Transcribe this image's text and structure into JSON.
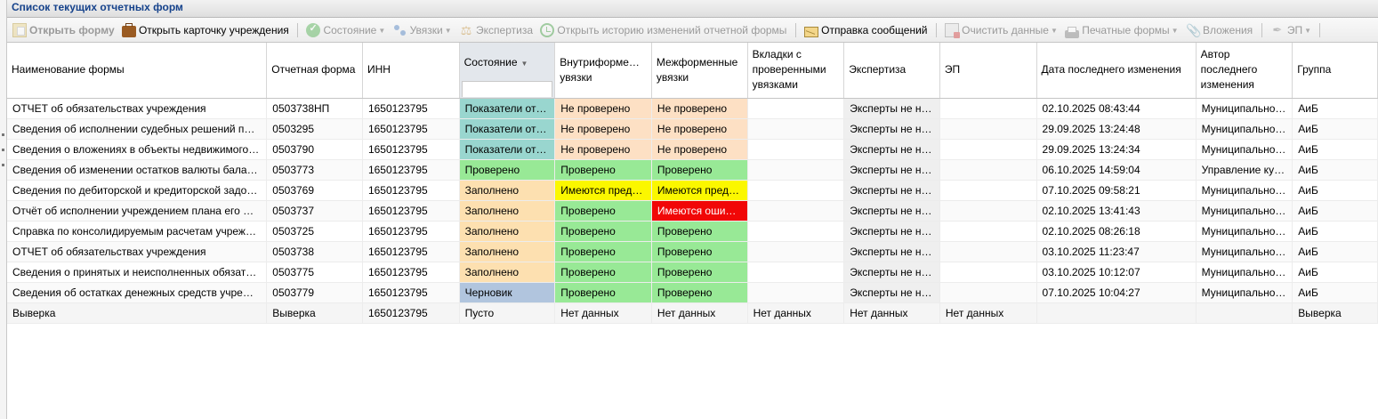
{
  "window": {
    "title": "Список текущих отчетных форм"
  },
  "colors": {
    "status_blue": "#99d6cf",
    "status_peach": "#fde0c4",
    "status_green": "#98e996",
    "status_orange": "#fde0b0",
    "status_yellow": "#fbf700",
    "status_red": "#f10707",
    "status_draft": "#b1c5de"
  },
  "toolbar": {
    "open_form": "Открыть форму",
    "open_card": "Открыть карточку учреждения",
    "state": "Состояние",
    "links": "Увязки",
    "expertise": "Экспертиза",
    "history": "Открыть историю изменений отчетной формы",
    "send_messages": "Отправка сообщений",
    "clear_data": "Очистить данные",
    "print_forms": "Печатные формы",
    "attachments": "Вложения",
    "ep": "ЭП"
  },
  "grid": {
    "columns": {
      "name": "Наименование формы",
      "report_form": "Отчетная форма",
      "inn": "ИНН",
      "state": "Состояние",
      "intra": [
        "Внутриформе…",
        "увязки"
      ],
      "inter": [
        "Межформенные",
        "увязки"
      ],
      "tabs": [
        "Вкладки с",
        "проверенными",
        "увязками"
      ],
      "expertise": "Экспертиза",
      "ep": "ЭП",
      "last_change": "Дата последнего изменения",
      "author": [
        "Автор",
        "последнего",
        "изменения"
      ],
      "group": "Группа"
    },
    "rows": [
      {
        "name": "ОТЧЕТ об обязательствах учреждения",
        "form": "0503738НП",
        "inn": "1650123795",
        "state": "Показатели от…",
        "intra": "Не проверено",
        "inter": "Не проверено",
        "tabs": "",
        "expertise": "Эксперты не н…",
        "ep": "",
        "date": "02.10.2025 08:43:44",
        "author": "Муниципально…",
        "group": "АиБ"
      },
      {
        "name": "Сведения об исполнении судебных решений п…",
        "form": "0503295",
        "inn": "1650123795",
        "state": "Показатели от…",
        "intra": "Не проверено",
        "inter": "Не проверено",
        "tabs": "",
        "expertise": "Эксперты не н…",
        "ep": "",
        "date": "29.09.2025 13:24:48",
        "author": "Муниципально…",
        "group": "АиБ"
      },
      {
        "name": "Сведения о вложениях в объекты недвижимого…",
        "form": "0503790",
        "inn": "1650123795",
        "state": "Показатели от…",
        "intra": "Не проверено",
        "inter": "Не проверено",
        "tabs": "",
        "expertise": "Эксперты не н…",
        "ep": "",
        "date": "29.09.2025 13:24:34",
        "author": "Муниципально…",
        "group": "АиБ"
      },
      {
        "name": "Сведения об изменении остатков валюты бала…",
        "form": "0503773",
        "inn": "1650123795",
        "state": "Проверено",
        "intra": "Проверено",
        "inter": "Проверено",
        "tabs": "",
        "expertise": "Эксперты не н…",
        "ep": "",
        "date": "06.10.2025 14:59:04",
        "author": "Управление ку…",
        "group": "АиБ"
      },
      {
        "name": "Сведения по дебиторской и кредиторской задо…",
        "form": "0503769",
        "inn": "1650123795",
        "state": "Заполнено",
        "intra": "Имеются пред…",
        "inter": "Имеются пред…",
        "tabs": "",
        "expertise": "Эксперты не н…",
        "ep": "",
        "date": "07.10.2025 09:58:21",
        "author": "Муниципально…",
        "group": "АиБ"
      },
      {
        "name": "Отчёт об исполнении учреждением плана его …",
        "form": "0503737",
        "inn": "1650123795",
        "state": "Заполнено",
        "intra": "Проверено",
        "inter": "Имеются ошибки",
        "tabs": "",
        "expertise": "Эксперты не н…",
        "ep": "",
        "date": "02.10.2025 13:41:43",
        "author": "Муниципально…",
        "group": "АиБ"
      },
      {
        "name": "Справка по консолидируемым расчетам учреж…",
        "form": "0503725",
        "inn": "1650123795",
        "state": "Заполнено",
        "intra": "Проверено",
        "inter": "Проверено",
        "tabs": "",
        "expertise": "Эксперты не н…",
        "ep": "",
        "date": "02.10.2025 08:26:18",
        "author": "Муниципально…",
        "group": "АиБ"
      },
      {
        "name": "ОТЧЕТ об обязательствах учреждения",
        "form": "0503738",
        "inn": "1650123795",
        "state": "Заполнено",
        "intra": "Проверено",
        "inter": "Проверено",
        "tabs": "",
        "expertise": "Эксперты не н…",
        "ep": "",
        "date": "03.10.2025 11:23:47",
        "author": "Муниципально…",
        "group": "АиБ"
      },
      {
        "name": "Сведения о принятых и неисполненных обязат…",
        "form": "0503775",
        "inn": "1650123795",
        "state": "Заполнено",
        "intra": "Проверено",
        "inter": "Проверено",
        "tabs": "",
        "expertise": "Эксперты не н…",
        "ep": "",
        "date": "03.10.2025 10:12:07",
        "author": "Муниципально…",
        "group": "АиБ"
      },
      {
        "name": "Сведения об остатках денежных средств учре…",
        "form": "0503779",
        "inn": "1650123795",
        "state": "Черновик",
        "intra": "Проверено",
        "inter": "Проверено",
        "tabs": "",
        "expertise": "Эксперты не н…",
        "ep": "",
        "date": "07.10.2025 10:04:27",
        "author": "Муниципально…",
        "group": "АиБ"
      },
      {
        "name": "Выверка",
        "form": "Выверка",
        "inn": "1650123795",
        "state": "Пусто",
        "intra": "Нет данных",
        "inter": "Нет данных",
        "tabs": "Нет данных",
        "expertise": "Нет данных",
        "ep": "Нет данных",
        "date": "",
        "author": "",
        "group": "Выверка"
      }
    ]
  }
}
